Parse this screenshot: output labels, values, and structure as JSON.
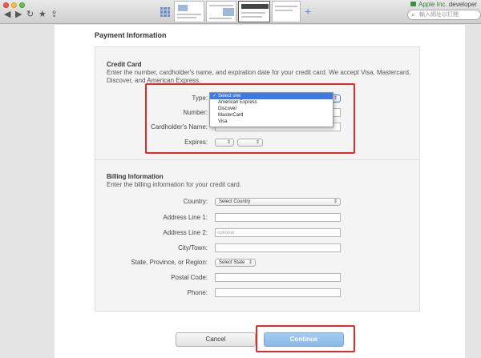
{
  "browser": {
    "apple_label": "Apple Inc.",
    "url_host": "developer",
    "search_placeholder": "輸入網址以打開",
    "new_tab_symbol": "+"
  },
  "page": {
    "title": "Payment Information",
    "credit_card": {
      "heading": "Credit Card",
      "description": "Enter the number, cardholder's name, and expiration date for your credit card. We accept Visa, Mastercard, Discover, and American Express.",
      "type_label": "Type:",
      "number_label": "Number:",
      "name_label": "Cardholder's Name:",
      "expires_label": "Expires:",
      "type_options": [
        "Select one",
        "American Express",
        "Discover",
        "MasterCard",
        "Visa"
      ],
      "type_selected": "Select one"
    },
    "billing": {
      "heading": "Billing Information",
      "description": "Enter the billing information for your credit card.",
      "country_label": "Country:",
      "country_value": "Select Country",
      "address1_label": "Address Line 1:",
      "address2_label": "Address Line 2:",
      "address2_placeholder": "optional",
      "city_label": "City/Town:",
      "state_label": "State, Province, or Region:",
      "state_value": "Select State",
      "postal_label": "Postal Code:",
      "phone_label": "Phone:"
    },
    "buttons": {
      "cancel": "Cancel",
      "continue": "Continue"
    }
  },
  "colors": {
    "highlight": "#e02a2a",
    "dropdown_selection": "#3c79e0",
    "continue_button": "#94c0ec"
  }
}
